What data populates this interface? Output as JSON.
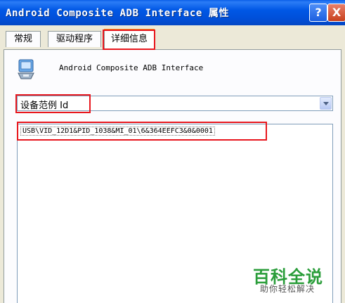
{
  "window": {
    "title": "Android Composite ADB Interface 属性",
    "help_label": "?",
    "close_label": "X"
  },
  "tabs": [
    {
      "label": "常规"
    },
    {
      "label": "驱动程序"
    },
    {
      "label": "详细信息",
      "selected": true
    }
  ],
  "device": {
    "icon": "usb-device-icon",
    "name": "Android Composite ADB Interface"
  },
  "property": {
    "selected": "设备范例 Id"
  },
  "values": [
    "USB\\VID_12D1&PID_1038&MI_01\\6&364EEFC3&0&0001"
  ],
  "watermark": {
    "main": "百科全说",
    "sub": "助你轻松解决"
  },
  "colors": {
    "titlebar": "#0054e3",
    "highlight_box": "#e8161d",
    "tab_accent": "#f39b1c",
    "watermark": "#2a9d3a"
  }
}
